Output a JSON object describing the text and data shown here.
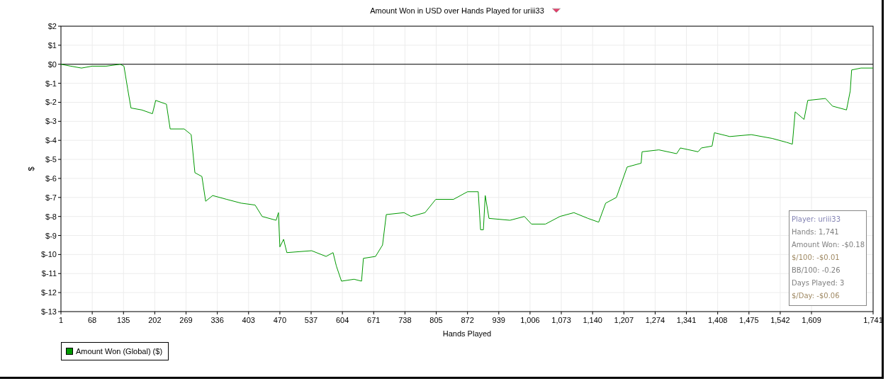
{
  "chart": {
    "chart_data": {
      "type": "line",
      "grid": true,
      "title": "Amount Won in USD over Hands Played for uriii33",
      "xlabel": "Hands Played",
      "ylabel": "$",
      "xlim": [
        1,
        1741
      ],
      "ylim": [
        -13,
        2
      ],
      "xticks": [
        1,
        68,
        135,
        202,
        269,
        336,
        403,
        470,
        537,
        604,
        671,
        738,
        805,
        872,
        939,
        {
          "value": 1006,
          "label": "1,006"
        },
        {
          "value": 1073,
          "label": "1,073"
        },
        {
          "value": 1140,
          "label": "1,140"
        },
        {
          "value": 1207,
          "label": "1,207"
        },
        {
          "value": 1274,
          "label": "1,274"
        },
        {
          "value": 1341,
          "label": "1,341"
        },
        {
          "value": 1408,
          "label": "1,408"
        },
        {
          "value": 1475,
          "label": "1,475"
        },
        {
          "value": 1542,
          "label": "1,542"
        },
        {
          "value": 1609,
          "label": "1,609"
        },
        {
          "value": 1741,
          "label": "1,741"
        }
      ],
      "yticks": [
        {
          "value": 2,
          "label": "$2"
        },
        {
          "value": 1,
          "label": "$1"
        },
        {
          "value": 0,
          "label": "$0"
        },
        {
          "value": -1,
          "label": "$-1"
        },
        {
          "value": -2,
          "label": "$-2"
        },
        {
          "value": -3,
          "label": "$-3"
        },
        {
          "value": -4,
          "label": "$-4"
        },
        {
          "value": -5,
          "label": "$-5"
        },
        {
          "value": -6,
          "label": "$-6"
        },
        {
          "value": -7,
          "label": "$-7"
        },
        {
          "value": -8,
          "label": "$-8"
        },
        {
          "value": -9,
          "label": "$-9"
        },
        {
          "value": -10,
          "label": "$-10"
        },
        {
          "value": -11,
          "label": "$-11"
        },
        {
          "value": -12,
          "label": "$-12"
        },
        {
          "value": -13,
          "label": "$-13"
        }
      ],
      "x": [
        1,
        22,
        45,
        68,
        98,
        128,
        136,
        144,
        151,
        174,
        197,
        204,
        227,
        235,
        265,
        280,
        288,
        303,
        311,
        326,
        356,
        387,
        417,
        432,
        462,
        467,
        470,
        478,
        485,
        538,
        569,
        584,
        591,
        602,
        629,
        645,
        649,
        675,
        690,
        698,
        736,
        751,
        781,
        804,
        842,
        872,
        895,
        900,
        906,
        910,
        918,
        963,
        994,
        1009,
        1039,
        1070,
        1100,
        1130,
        1153,
        1168,
        1191,
        1214,
        1244,
        1246,
        1282,
        1320,
        1328,
        1366,
        1373,
        1396,
        1401,
        1434,
        1480,
        1525,
        1555,
        1568,
        1574,
        1593,
        1601,
        1639,
        1654,
        1684,
        1692,
        1695,
        1715,
        1741
      ],
      "series": [
        {
          "name": "Amount Won (Global) ($)",
          "color": "#009900",
          "values": [
            0,
            -0.1,
            -0.2,
            -0.1,
            -0.1,
            0,
            -0.1,
            -1.3,
            -2.3,
            -2.4,
            -2.6,
            -1.9,
            -2.1,
            -3.4,
            -3.4,
            -3.7,
            -5.7,
            -5.9,
            -7.2,
            -6.9,
            -7.1,
            -7.3,
            -7.4,
            -8,
            -8.2,
            -7.8,
            -9.6,
            -9.2,
            -9.9,
            -9.8,
            -10.1,
            -9.9,
            -10.6,
            -11.4,
            -11.3,
            -11.4,
            -10.2,
            -10.1,
            -9.5,
            -7.9,
            -7.8,
            -8,
            -7.8,
            -7.1,
            -7.1,
            -6.7,
            -6.7,
            -8.7,
            -8.7,
            -6.9,
            -8.1,
            -8.2,
            -8,
            -8.4,
            -8.4,
            -8,
            -7.8,
            -8.1,
            -8.3,
            -7.3,
            -7,
            -5.4,
            -5.2,
            -4.6,
            -4.5,
            -4.7,
            -4.4,
            -4.6,
            -4.4,
            -4.3,
            -3.6,
            -3.8,
            -3.7,
            -3.9,
            -4.1,
            -4.2,
            -2.5,
            -2.9,
            -1.9,
            -1.8,
            -2.2,
            -2.4,
            -1.4,
            -0.3,
            -0.2,
            -0.2
          ]
        }
      ]
    }
  },
  "stats": [
    {
      "text": "Player: uriii33",
      "color": "#8484b4"
    },
    {
      "text": "Hands: 1,741",
      "color": "#808080"
    },
    {
      "text": "Amount Won: -$0.18",
      "color": "#808080"
    },
    {
      "text": "$/100: -$0.01",
      "color": "#a08a64"
    },
    {
      "text": "BB/100: -0.26",
      "color": "#808080"
    },
    {
      "text": "Days Played: 3",
      "color": "#808080"
    },
    {
      "text": "$/Day: -$0.06",
      "color": "#a08a64"
    }
  ]
}
